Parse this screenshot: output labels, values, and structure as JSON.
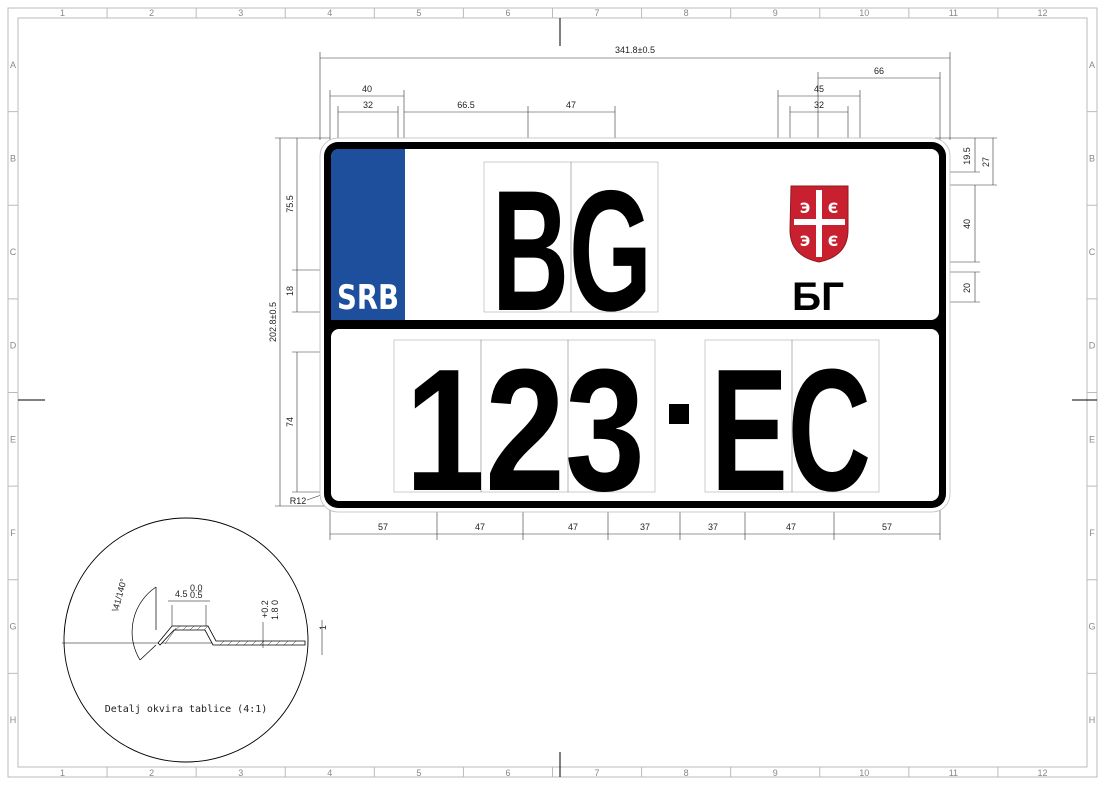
{
  "sheet": {
    "columns": [
      "1",
      "2",
      "3",
      "4",
      "5",
      "6",
      "7",
      "8",
      "9",
      "10",
      "11",
      "12"
    ],
    "rows": [
      "A",
      "B",
      "C",
      "D",
      "E",
      "F",
      "G",
      "H"
    ]
  },
  "plate": {
    "country_code": "SRB",
    "city_code": "BG",
    "city_code_cyrillic": "БГ",
    "registration_digits": "123",
    "separator": "·",
    "registration_letters": "EC",
    "band_color": "#1d4f9c",
    "coat_of_arms_red": "#c8202f"
  },
  "dimensions": {
    "overall_width": "341.8±0.5",
    "overall_height": "202.8±0.5",
    "band_width": "40",
    "band_inner": "32",
    "gap_to_letters": "66.5",
    "letter_width_top": "47",
    "right_offset": "66",
    "arms_width": "45",
    "arms_inner": "32",
    "top_row_height": "75.5",
    "srb_text_height": "18",
    "letter_height_top": "74",
    "letter_height_bottom": "74",
    "right_top_margin": "19.5",
    "right_top_total": "27",
    "arms_height": "40",
    "cyrillic_height": "20",
    "corner_radius": "R12",
    "bottom_57_left": "57",
    "bottom_47_a": "47",
    "bottom_47_b": "47",
    "bottom_37_a": "37",
    "bottom_37_b": "37",
    "bottom_47_c": "47",
    "bottom_57_right": "57"
  },
  "detail": {
    "caption": "Detalj okvira tablice (4:1)",
    "angle": "\\41/140°",
    "width": "4.5",
    "width_tol_upper": "0.0",
    "width_tol_lower": "0.5",
    "height_tol": "+0.2",
    "height": "1.8 0",
    "thickness": "1"
  }
}
